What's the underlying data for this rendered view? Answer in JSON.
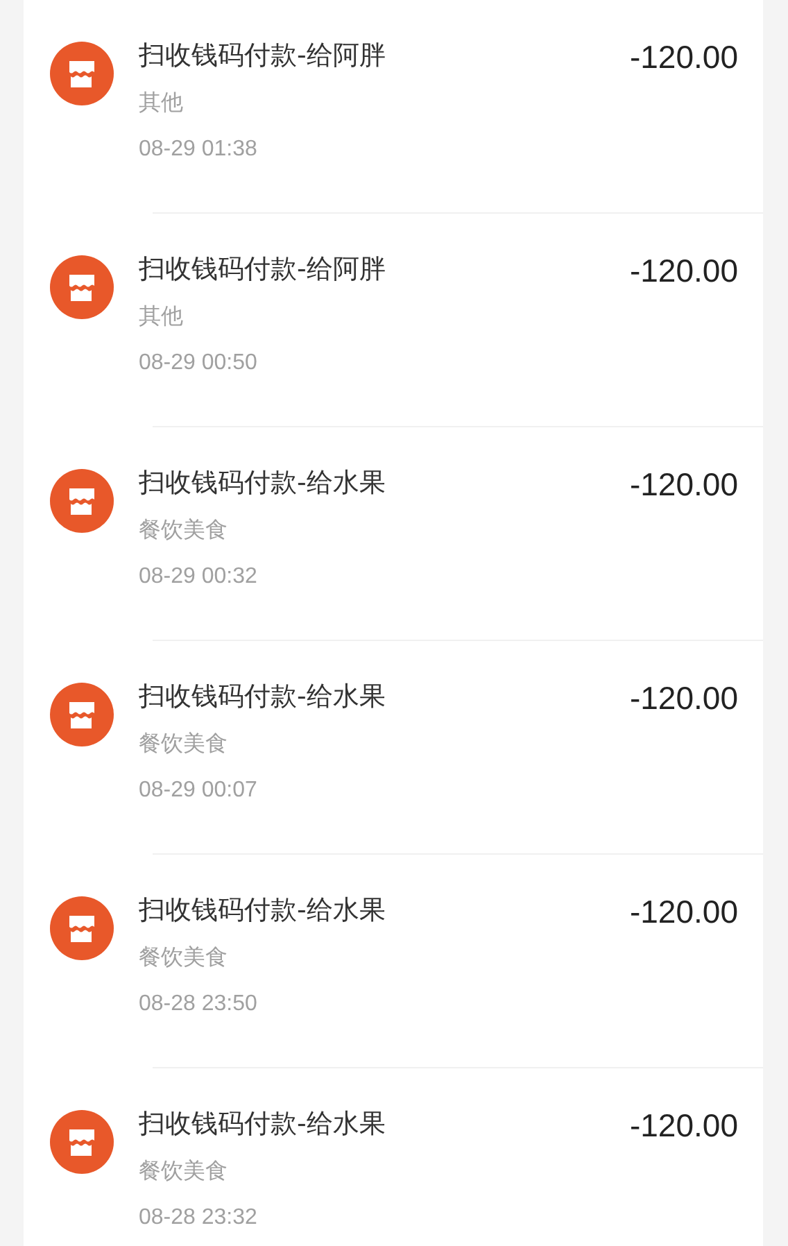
{
  "transactions": [
    {
      "title": "扫收钱码付款-给阿胖",
      "category": "其他",
      "time": "08-29 01:38",
      "amount": "-120.00"
    },
    {
      "title": "扫收钱码付款-给阿胖",
      "category": "其他",
      "time": "08-29 00:50",
      "amount": "-120.00"
    },
    {
      "title": "扫收钱码付款-给水果",
      "category": "餐饮美食",
      "time": "08-29 00:32",
      "amount": "-120.00"
    },
    {
      "title": "扫收钱码付款-给水果",
      "category": "餐饮美食",
      "time": "08-29 00:07",
      "amount": "-120.00"
    },
    {
      "title": "扫收钱码付款-给水果",
      "category": "餐饮美食",
      "time": "08-28 23:50",
      "amount": "-120.00"
    },
    {
      "title": "扫收钱码付款-给水果",
      "category": "餐饮美食",
      "time": "08-28 23:32",
      "amount": "-120.00"
    }
  ]
}
